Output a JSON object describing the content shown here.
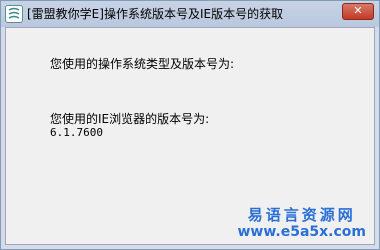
{
  "window": {
    "title": "[雷盟教你学E]操作系统版本号及IE版本号的获取",
    "close_label": "✕",
    "icon": "app-logo-icon"
  },
  "content": {
    "os_label": "您使用的操作系统类型及版本号为:",
    "os_value": "",
    "ie_label": "您使用的IE浏览器的版本号为:",
    "ie_value": "6.1.7600"
  },
  "watermark": {
    "line1": "易语言资源网",
    "line2": "www.e5a5x.com"
  },
  "colors": {
    "watermark": "#2a6fd6",
    "close_button": "#c23a25"
  }
}
